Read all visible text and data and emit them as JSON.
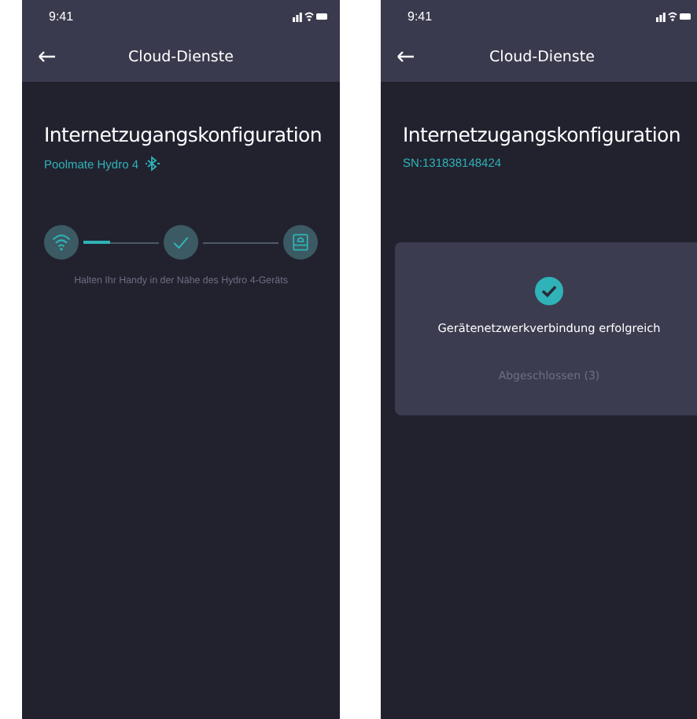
{
  "screens": [
    {
      "kind": "progress",
      "status_bar": {
        "time": "9:41"
      },
      "nav": {
        "title": "Cloud-Dienste"
      },
      "heading": "Internetzugangskonfiguration",
      "subtitle": "Poolmate Hydro 4",
      "bluetooth": true,
      "connector": {
        "level": 0.35
      },
      "hint": "Halten Ihr Handy in der Nähe des Hydro 4-Geräts"
    },
    {
      "kind": "success",
      "status_bar": {
        "time": "9:41"
      },
      "nav": {
        "title": "Cloud-Dienste"
      },
      "heading": "Internetzugangskonfiguration",
      "subtitle": "SN:131838148424",
      "bluetooth": false,
      "message": "Gerätenetzwerkverbindung erfolgreich",
      "button": "Abgeschlossen (3)"
    }
  ]
}
